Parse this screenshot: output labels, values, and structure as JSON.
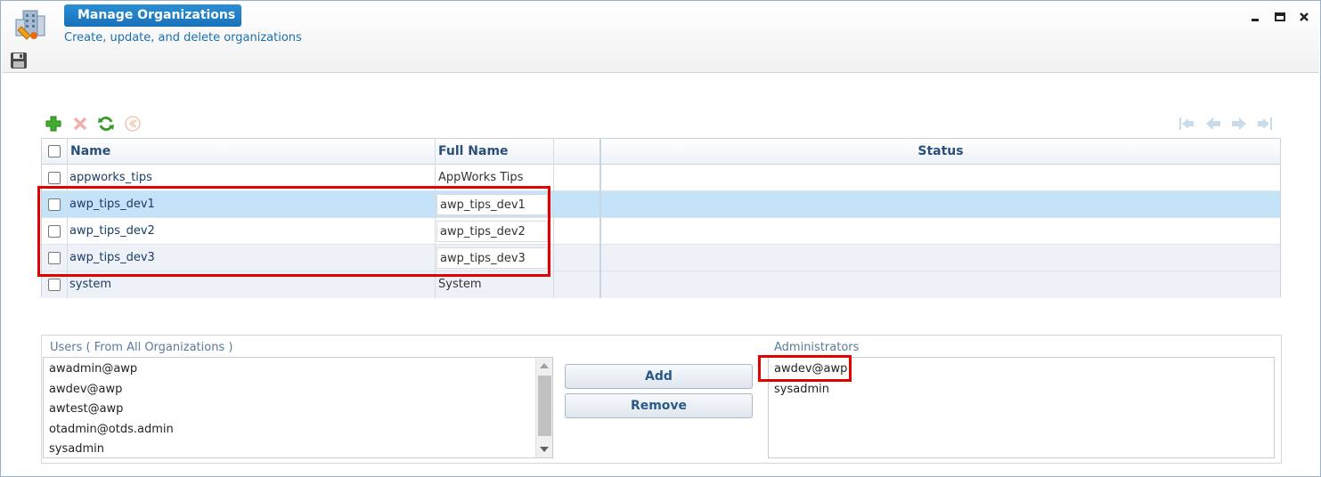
{
  "header": {
    "title": "Manage Organizations",
    "subtitle": "Create, update, and delete organizations"
  },
  "icons": {
    "app": "organizations-building-icon",
    "save": "save-icon",
    "add": "add-icon",
    "delete": "delete-icon",
    "refresh": "refresh-icon",
    "history": "history-icon",
    "first": "first-page-icon",
    "prev": "previous-page-icon",
    "next": "next-page-icon",
    "last": "last-page-icon"
  },
  "grid": {
    "columns": {
      "name": "Name",
      "full_name": "Full Name",
      "status": "Status"
    },
    "rows": [
      {
        "name": "appworks_tips",
        "full_name": "AppWorks Tips"
      },
      {
        "name": "awp_tips_dev1",
        "full_name": "awp_tips_dev1"
      },
      {
        "name": "awp_tips_dev2",
        "full_name": "awp_tips_dev2"
      },
      {
        "name": "awp_tips_dev3",
        "full_name": "awp_tips_dev3"
      },
      {
        "name": "system",
        "full_name": "System"
      }
    ]
  },
  "users": {
    "label": "Users ( From All Organizations )",
    "items": [
      "awadmin@awp",
      "awdev@awp",
      "awtest@awp",
      "otadmin@otds.admin",
      "sysadmin"
    ]
  },
  "actions": {
    "add": "Add",
    "remove": "Remove"
  },
  "administrators": {
    "label": "Administrators",
    "items": [
      "awdev@awp",
      "sysadmin"
    ]
  },
  "colors": {
    "accent": "#1870b8",
    "selected_row": "#c4e2f8",
    "highlight": "#e00000"
  }
}
